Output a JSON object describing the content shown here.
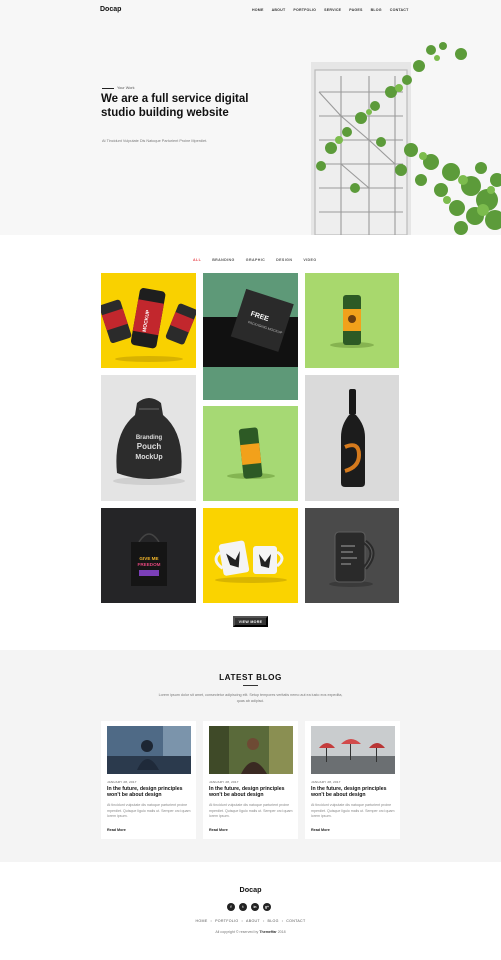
{
  "header": {
    "logo": "Docap",
    "nav": [
      "HOME",
      "ABOUT",
      "PORTFOLIO",
      "SERVICE",
      "PAGES",
      "BLOG",
      "CONTACT"
    ]
  },
  "hero": {
    "tag": "Your Work",
    "title": "We are a full service digital studio building website",
    "subtitle": "At Tincidunt Vulputate Dis Natoque Parturient Proine Mperdiet."
  },
  "portfolio": {
    "filters": [
      "ALL",
      "BRANDING",
      "GRAPHIC",
      "DESIGN",
      "VIDEO"
    ],
    "active_filter": "ALL",
    "tile_texts": {
      "can_label": "MOCKUP",
      "box_title": "FREE",
      "box_sub": "PACKAGING MOCKUP",
      "pouch_line1": "Branding",
      "pouch_line2": "Pouch",
      "pouch_line3": "MockUp",
      "bag_line1": "GIVE ME",
      "bag_line2": "FREEDOM"
    },
    "view_more": "VIEW MORE"
  },
  "blog": {
    "title": "LATEST BLOG",
    "description": "Lorem ipsum dolor sit amet, consectetur adipiscing elit. Setup tempores veritatis nemo aut ea iusto eos expedita, quas ab adipisci.",
    "posts": [
      {
        "date": "JANUARY 28, 2017",
        "title": "In the future, design principles won't be about design",
        "text": "At tincidunt vulputate dis natoque parturient proine mperdiet. Quisque ligulo malis ut. Semper orci quam lorem ipsum.",
        "link": "Read More"
      },
      {
        "date": "JANUARY 28, 2017",
        "title": "In the future, design principles won't be about design",
        "text": "At tincidunt vulputate dis natoque parturient proine mperdiet. Quisque ligulo malis ut. Semper orci quam lorem ipsum.",
        "link": "Read More"
      },
      {
        "date": "JANUARY 28, 2017",
        "title": "In the future, design principles won't be about design",
        "text": "At tincidunt vulputate dis natoque parturient proine mperdiet. Quisque ligulo malis ut. Semper orci quam lorem ipsum.",
        "link": "Read More"
      }
    ]
  },
  "footer": {
    "logo": "Docap",
    "socials": [
      "f",
      "t",
      "in",
      "g+"
    ],
    "links": [
      "HOME",
      "PORTFOLIO",
      "ABOUT",
      "BLOG",
      "CONTACT"
    ],
    "copyright_prefix": "All copyright © reserved by",
    "copyright_brand": "Themeffar",
    "copyright_suffix": "2018"
  },
  "colors": {
    "accent": "#e8454b",
    "dark_button": "#333333",
    "yellow": "#f9d100",
    "green": "#a8d86d",
    "teal_green": "#5e9978"
  }
}
